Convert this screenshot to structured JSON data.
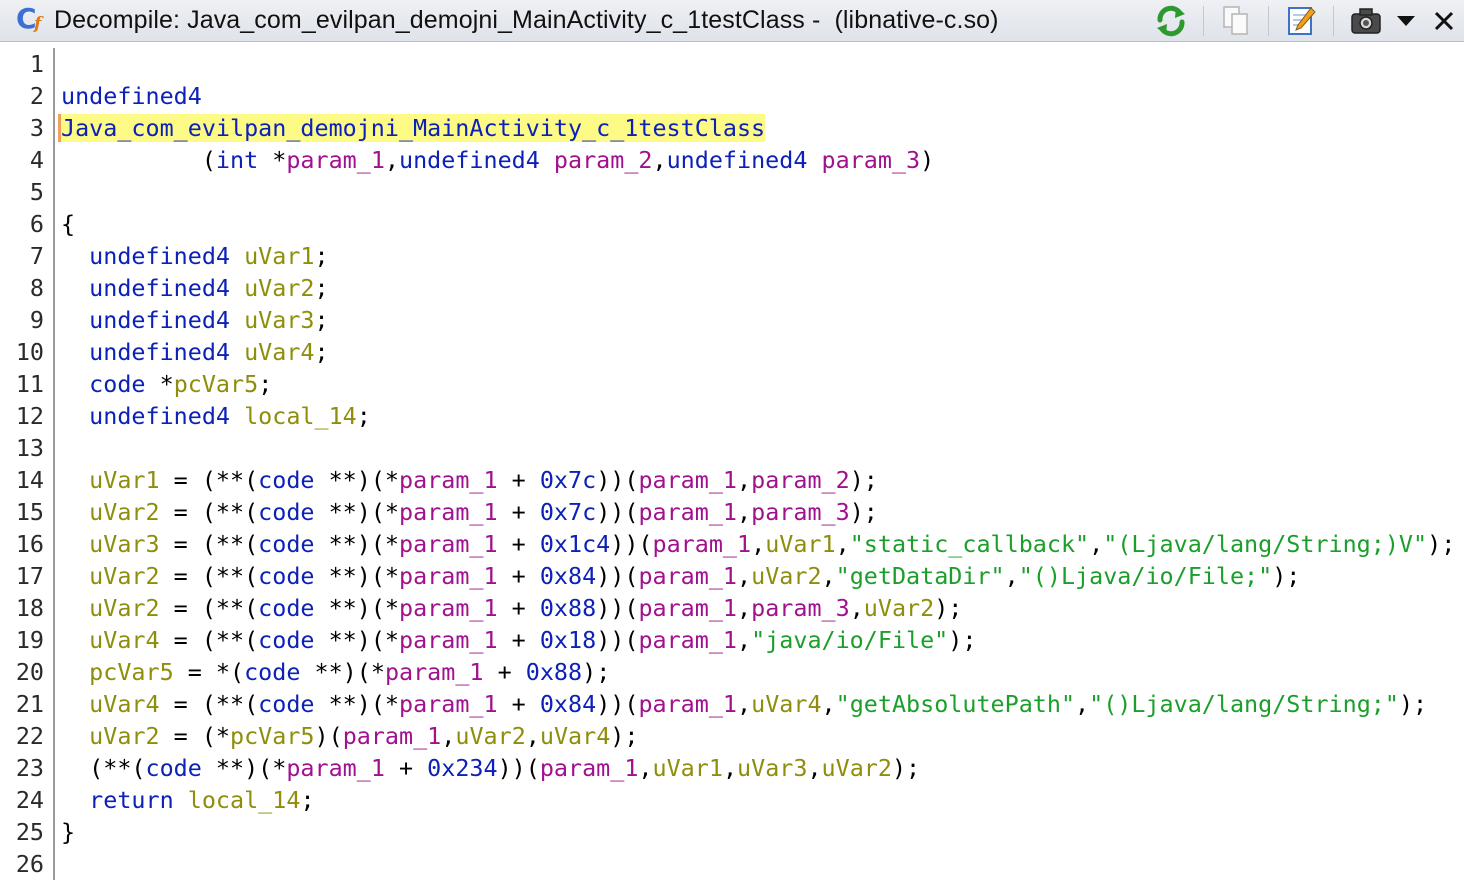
{
  "window": {
    "title": "Decompile: Java_com_evilpan_demojni_MainActivity_c_1testClass -  (libnative-c.so)",
    "icons": [
      "decompile-app-icon",
      "refresh-icon",
      "copy-icon",
      "edit-icon",
      "snapshot-icon",
      "dropdown-menu-icon",
      "close-icon"
    ]
  },
  "colors": {
    "keyword": "#0c21b8",
    "parameter": "#a0108f",
    "local_variable": "#8e8e0c",
    "string": "#1b9f2a",
    "function_highlight": "#fdfa85"
  },
  "code": {
    "line_numbers": [
      "1",
      "2",
      "3",
      "4",
      "5",
      "6",
      "7",
      "8",
      "9",
      "10",
      "11",
      "12",
      "13",
      "14",
      "15",
      "16",
      "17",
      "18",
      "19",
      "20",
      "21",
      "22",
      "23",
      "24",
      "25",
      "26"
    ],
    "lines": [
      [],
      [
        {
          "t": "kw",
          "v": "undefined4"
        }
      ],
      [
        {
          "t": "fn",
          "v": "Java_com_evilpan_demojni_MainActivity_c_1testClass"
        }
      ],
      [
        {
          "t": "op",
          "v": "          ("
        },
        {
          "t": "kw",
          "v": "int"
        },
        {
          "t": "op",
          "v": " *"
        },
        {
          "t": "pm",
          "v": "param_1"
        },
        {
          "t": "op",
          "v": ","
        },
        {
          "t": "kw",
          "v": "undefined4"
        },
        {
          "t": "op",
          "v": " "
        },
        {
          "t": "pm",
          "v": "param_2"
        },
        {
          "t": "op",
          "v": ","
        },
        {
          "t": "kw",
          "v": "undefined4"
        },
        {
          "t": "op",
          "v": " "
        },
        {
          "t": "pm",
          "v": "param_3"
        },
        {
          "t": "op",
          "v": ")"
        }
      ],
      [],
      [
        {
          "t": "op",
          "v": "{"
        }
      ],
      [
        {
          "t": "op",
          "v": "  "
        },
        {
          "t": "kw",
          "v": "undefined4"
        },
        {
          "t": "op",
          "v": " "
        },
        {
          "t": "lv",
          "v": "uVar1"
        },
        {
          "t": "op",
          "v": ";"
        }
      ],
      [
        {
          "t": "op",
          "v": "  "
        },
        {
          "t": "kw",
          "v": "undefined4"
        },
        {
          "t": "op",
          "v": " "
        },
        {
          "t": "lv",
          "v": "uVar2"
        },
        {
          "t": "op",
          "v": ";"
        }
      ],
      [
        {
          "t": "op",
          "v": "  "
        },
        {
          "t": "kw",
          "v": "undefined4"
        },
        {
          "t": "op",
          "v": " "
        },
        {
          "t": "lv",
          "v": "uVar3"
        },
        {
          "t": "op",
          "v": ";"
        }
      ],
      [
        {
          "t": "op",
          "v": "  "
        },
        {
          "t": "kw",
          "v": "undefined4"
        },
        {
          "t": "op",
          "v": " "
        },
        {
          "t": "lv",
          "v": "uVar4"
        },
        {
          "t": "op",
          "v": ";"
        }
      ],
      [
        {
          "t": "op",
          "v": "  "
        },
        {
          "t": "kw",
          "v": "code"
        },
        {
          "t": "op",
          "v": " *"
        },
        {
          "t": "lv",
          "v": "pcVar5"
        },
        {
          "t": "op",
          "v": ";"
        }
      ],
      [
        {
          "t": "op",
          "v": "  "
        },
        {
          "t": "kw",
          "v": "undefined4"
        },
        {
          "t": "op",
          "v": " "
        },
        {
          "t": "lv",
          "v": "local_14"
        },
        {
          "t": "op",
          "v": ";"
        }
      ],
      [],
      [
        {
          "t": "op",
          "v": "  "
        },
        {
          "t": "lv",
          "v": "uVar1"
        },
        {
          "t": "op",
          "v": " = (**("
        },
        {
          "t": "kw",
          "v": "code"
        },
        {
          "t": "op",
          "v": " **)(*"
        },
        {
          "t": "pm",
          "v": "param_1"
        },
        {
          "t": "op",
          "v": " + "
        },
        {
          "t": "nm",
          "v": "0x7c"
        },
        {
          "t": "op",
          "v": "))("
        },
        {
          "t": "pm",
          "v": "param_1"
        },
        {
          "t": "op",
          "v": ","
        },
        {
          "t": "pm",
          "v": "param_2"
        },
        {
          "t": "op",
          "v": ");"
        }
      ],
      [
        {
          "t": "op",
          "v": "  "
        },
        {
          "t": "lv",
          "v": "uVar2"
        },
        {
          "t": "op",
          "v": " = (**("
        },
        {
          "t": "kw",
          "v": "code"
        },
        {
          "t": "op",
          "v": " **)(*"
        },
        {
          "t": "pm",
          "v": "param_1"
        },
        {
          "t": "op",
          "v": " + "
        },
        {
          "t": "nm",
          "v": "0x7c"
        },
        {
          "t": "op",
          "v": "))("
        },
        {
          "t": "pm",
          "v": "param_1"
        },
        {
          "t": "op",
          "v": ","
        },
        {
          "t": "pm",
          "v": "param_3"
        },
        {
          "t": "op",
          "v": ");"
        }
      ],
      [
        {
          "t": "op",
          "v": "  "
        },
        {
          "t": "lv",
          "v": "uVar3"
        },
        {
          "t": "op",
          "v": " = (**("
        },
        {
          "t": "kw",
          "v": "code"
        },
        {
          "t": "op",
          "v": " **)(*"
        },
        {
          "t": "pm",
          "v": "param_1"
        },
        {
          "t": "op",
          "v": " + "
        },
        {
          "t": "nm",
          "v": "0x1c4"
        },
        {
          "t": "op",
          "v": "))("
        },
        {
          "t": "pm",
          "v": "param_1"
        },
        {
          "t": "op",
          "v": ","
        },
        {
          "t": "lv",
          "v": "uVar1"
        },
        {
          "t": "op",
          "v": ","
        },
        {
          "t": "st",
          "v": "\"static_callback\""
        },
        {
          "t": "op",
          "v": ","
        },
        {
          "t": "st",
          "v": "\"(Ljava/lang/String;)V\""
        },
        {
          "t": "op",
          "v": ");"
        }
      ],
      [
        {
          "t": "op",
          "v": "  "
        },
        {
          "t": "lv",
          "v": "uVar2"
        },
        {
          "t": "op",
          "v": " = (**("
        },
        {
          "t": "kw",
          "v": "code"
        },
        {
          "t": "op",
          "v": " **)(*"
        },
        {
          "t": "pm",
          "v": "param_1"
        },
        {
          "t": "op",
          "v": " + "
        },
        {
          "t": "nm",
          "v": "0x84"
        },
        {
          "t": "op",
          "v": "))("
        },
        {
          "t": "pm",
          "v": "param_1"
        },
        {
          "t": "op",
          "v": ","
        },
        {
          "t": "lv",
          "v": "uVar2"
        },
        {
          "t": "op",
          "v": ","
        },
        {
          "t": "st",
          "v": "\"getDataDir\""
        },
        {
          "t": "op",
          "v": ","
        },
        {
          "t": "st",
          "v": "\"()Ljava/io/File;\""
        },
        {
          "t": "op",
          "v": ");"
        }
      ],
      [
        {
          "t": "op",
          "v": "  "
        },
        {
          "t": "lv",
          "v": "uVar2"
        },
        {
          "t": "op",
          "v": " = (**("
        },
        {
          "t": "kw",
          "v": "code"
        },
        {
          "t": "op",
          "v": " **)(*"
        },
        {
          "t": "pm",
          "v": "param_1"
        },
        {
          "t": "op",
          "v": " + "
        },
        {
          "t": "nm",
          "v": "0x88"
        },
        {
          "t": "op",
          "v": "))("
        },
        {
          "t": "pm",
          "v": "param_1"
        },
        {
          "t": "op",
          "v": ","
        },
        {
          "t": "pm",
          "v": "param_3"
        },
        {
          "t": "op",
          "v": ","
        },
        {
          "t": "lv",
          "v": "uVar2"
        },
        {
          "t": "op",
          "v": ");"
        }
      ],
      [
        {
          "t": "op",
          "v": "  "
        },
        {
          "t": "lv",
          "v": "uVar4"
        },
        {
          "t": "op",
          "v": " = (**("
        },
        {
          "t": "kw",
          "v": "code"
        },
        {
          "t": "op",
          "v": " **)(*"
        },
        {
          "t": "pm",
          "v": "param_1"
        },
        {
          "t": "op",
          "v": " + "
        },
        {
          "t": "nm",
          "v": "0x18"
        },
        {
          "t": "op",
          "v": "))("
        },
        {
          "t": "pm",
          "v": "param_1"
        },
        {
          "t": "op",
          "v": ","
        },
        {
          "t": "st",
          "v": "\"java/io/File\""
        },
        {
          "t": "op",
          "v": ");"
        }
      ],
      [
        {
          "t": "op",
          "v": "  "
        },
        {
          "t": "lv",
          "v": "pcVar5"
        },
        {
          "t": "op",
          "v": " = *("
        },
        {
          "t": "kw",
          "v": "code"
        },
        {
          "t": "op",
          "v": " **)(*"
        },
        {
          "t": "pm",
          "v": "param_1"
        },
        {
          "t": "op",
          "v": " + "
        },
        {
          "t": "nm",
          "v": "0x88"
        },
        {
          "t": "op",
          "v": ");"
        }
      ],
      [
        {
          "t": "op",
          "v": "  "
        },
        {
          "t": "lv",
          "v": "uVar4"
        },
        {
          "t": "op",
          "v": " = (**("
        },
        {
          "t": "kw",
          "v": "code"
        },
        {
          "t": "op",
          "v": " **)(*"
        },
        {
          "t": "pm",
          "v": "param_1"
        },
        {
          "t": "op",
          "v": " + "
        },
        {
          "t": "nm",
          "v": "0x84"
        },
        {
          "t": "op",
          "v": "))("
        },
        {
          "t": "pm",
          "v": "param_1"
        },
        {
          "t": "op",
          "v": ","
        },
        {
          "t": "lv",
          "v": "uVar4"
        },
        {
          "t": "op",
          "v": ","
        },
        {
          "t": "st",
          "v": "\"getAbsolutePath\""
        },
        {
          "t": "op",
          "v": ","
        },
        {
          "t": "st",
          "v": "\"()Ljava/lang/String;\""
        },
        {
          "t": "op",
          "v": ");"
        }
      ],
      [
        {
          "t": "op",
          "v": "  "
        },
        {
          "t": "lv",
          "v": "uVar2"
        },
        {
          "t": "op",
          "v": " = (*"
        },
        {
          "t": "lv",
          "v": "pcVar5"
        },
        {
          "t": "op",
          "v": ")("
        },
        {
          "t": "pm",
          "v": "param_1"
        },
        {
          "t": "op",
          "v": ","
        },
        {
          "t": "lv",
          "v": "uVar2"
        },
        {
          "t": "op",
          "v": ","
        },
        {
          "t": "lv",
          "v": "uVar4"
        },
        {
          "t": "op",
          "v": ");"
        }
      ],
      [
        {
          "t": "op",
          "v": "  (**("
        },
        {
          "t": "kw",
          "v": "code"
        },
        {
          "t": "op",
          "v": " **)(*"
        },
        {
          "t": "pm",
          "v": "param_1"
        },
        {
          "t": "op",
          "v": " + "
        },
        {
          "t": "nm",
          "v": "0x234"
        },
        {
          "t": "op",
          "v": "))("
        },
        {
          "t": "pm",
          "v": "param_1"
        },
        {
          "t": "op",
          "v": ","
        },
        {
          "t": "lv",
          "v": "uVar1"
        },
        {
          "t": "op",
          "v": ","
        },
        {
          "t": "lv",
          "v": "uVar3"
        },
        {
          "t": "op",
          "v": ","
        },
        {
          "t": "lv",
          "v": "uVar2"
        },
        {
          "t": "op",
          "v": ");"
        }
      ],
      [
        {
          "t": "op",
          "v": "  "
        },
        {
          "t": "kw",
          "v": "return"
        },
        {
          "t": "op",
          "v": " "
        },
        {
          "t": "lv",
          "v": "local_14"
        },
        {
          "t": "op",
          "v": ";"
        }
      ],
      [
        {
          "t": "op",
          "v": "}"
        }
      ],
      []
    ]
  }
}
